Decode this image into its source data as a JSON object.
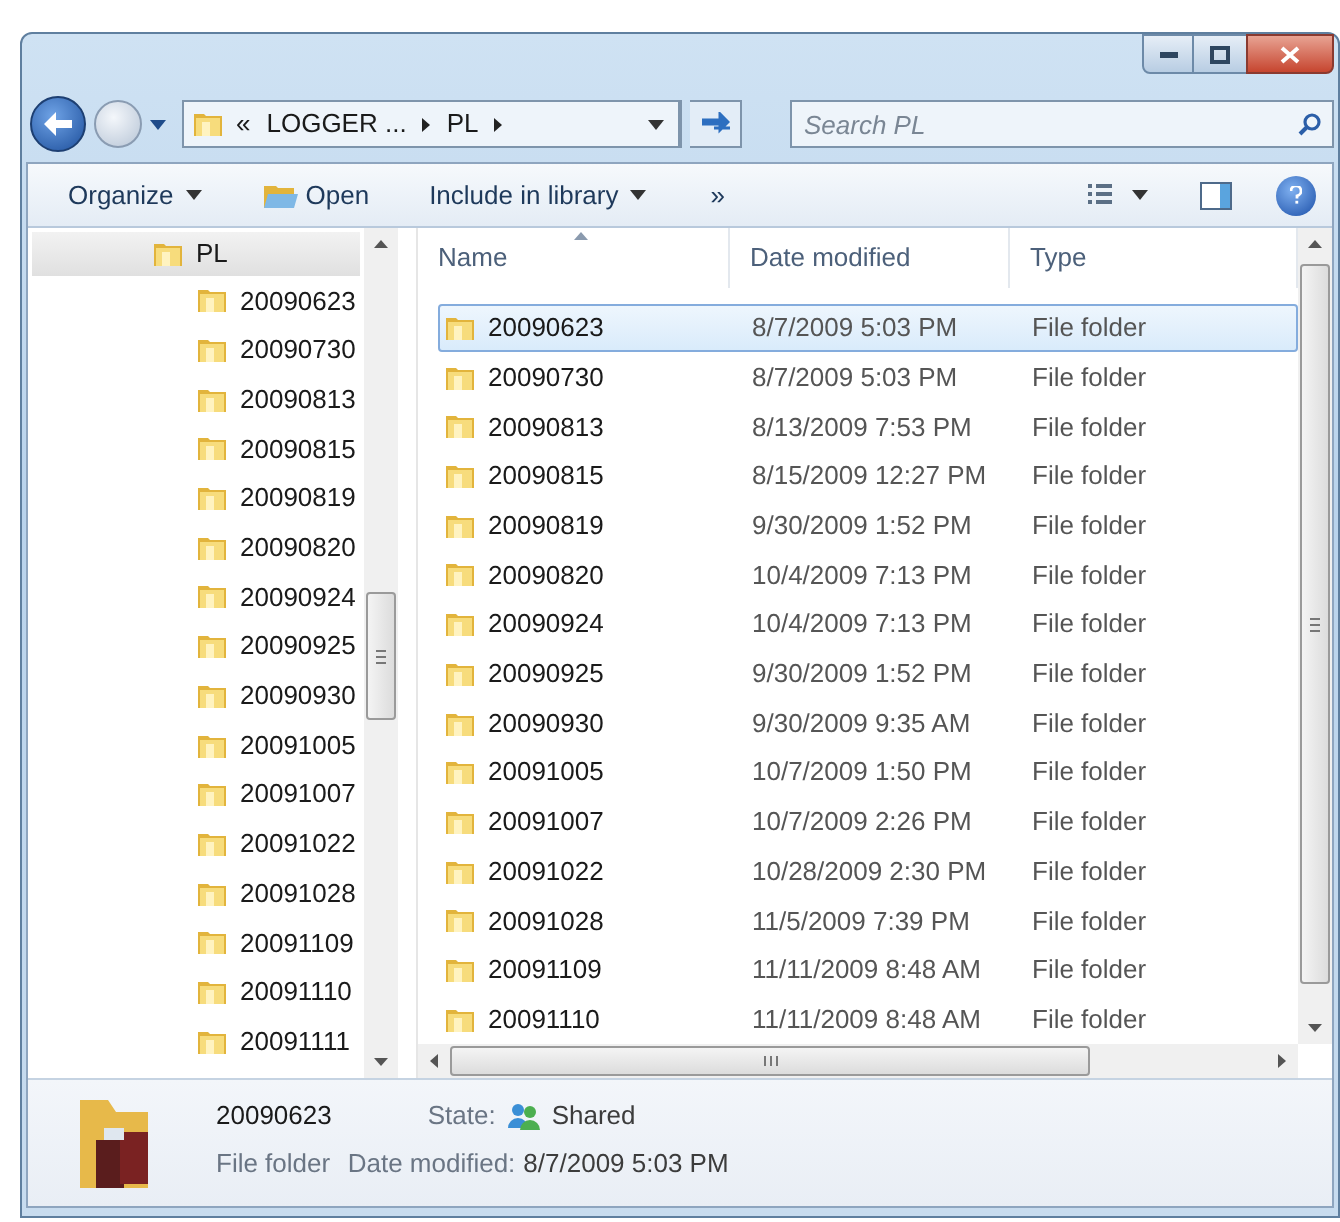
{
  "address": {
    "overflow": "«",
    "crumbs": [
      "LOGGER ...",
      "PL"
    ]
  },
  "search": {
    "placeholder": "Search PL"
  },
  "toolbar": {
    "items": [
      {
        "label": "Organize",
        "kind": "menu"
      },
      {
        "label": "Open",
        "kind": "icon"
      },
      {
        "label": "Include in library",
        "kind": "menu"
      },
      {
        "label": "»",
        "kind": "plain"
      }
    ]
  },
  "nav": {
    "items": [
      {
        "label": "PL",
        "selected": true,
        "children": [
          {
            "label": "20090623",
            "selected": false
          },
          {
            "label": "20090730",
            "selected": false
          },
          {
            "label": "20090813",
            "selected": false
          },
          {
            "label": "20090815",
            "selected": false
          },
          {
            "label": "20090819",
            "selected": false
          },
          {
            "label": "20090820",
            "selected": false
          },
          {
            "label": "20090924",
            "selected": false
          },
          {
            "label": "20090925",
            "selected": false
          },
          {
            "label": "20090930",
            "selected": false
          },
          {
            "label": "20091005",
            "selected": false
          },
          {
            "label": "20091007",
            "selected": false
          },
          {
            "label": "20091022",
            "selected": false
          },
          {
            "label": "20091028",
            "selected": false
          },
          {
            "label": "20091109",
            "selected": false
          },
          {
            "label": "20091110",
            "selected": false
          },
          {
            "label": "20091111",
            "selected": false
          }
        ]
      }
    ]
  },
  "table": {
    "columns": [
      {
        "label": "Name",
        "sorted": true
      },
      {
        "label": "Date modified",
        "sorted": false
      },
      {
        "label": "Type",
        "sorted": false
      }
    ],
    "rows": [
      {
        "name": "20090623",
        "date": "8/7/2009 5:03 PM",
        "type": "File folder",
        "selected": true
      },
      {
        "name": "20090730",
        "date": "8/7/2009 5:03 PM",
        "type": "File folder",
        "selected": false
      },
      {
        "name": "20090813",
        "date": "8/13/2009 7:53 PM",
        "type": "File folder",
        "selected": false
      },
      {
        "name": "20090815",
        "date": "8/15/2009 12:27 PM",
        "type": "File folder",
        "selected": false
      },
      {
        "name": "20090819",
        "date": "9/30/2009 1:52 PM",
        "type": "File folder",
        "selected": false
      },
      {
        "name": "20090820",
        "date": "10/4/2009 7:13 PM",
        "type": "File folder",
        "selected": false
      },
      {
        "name": "20090924",
        "date": "10/4/2009 7:13 PM",
        "type": "File folder",
        "selected": false
      },
      {
        "name": "20090925",
        "date": "9/30/2009 1:52 PM",
        "type": "File folder",
        "selected": false
      },
      {
        "name": "20090930",
        "date": "9/30/2009 9:35 AM",
        "type": "File folder",
        "selected": false
      },
      {
        "name": "20091005",
        "date": "10/7/2009 1:50 PM",
        "type": "File folder",
        "selected": false
      },
      {
        "name": "20091007",
        "date": "10/7/2009 2:26 PM",
        "type": "File folder",
        "selected": false
      },
      {
        "name": "20091022",
        "date": "10/28/2009 2:30 PM",
        "type": "File folder",
        "selected": false
      },
      {
        "name": "20091028",
        "date": "11/5/2009 7:39 PM",
        "type": "File folder",
        "selected": false
      },
      {
        "name": "20091109",
        "date": "11/11/2009 8:48 AM",
        "type": "File folder",
        "selected": false
      },
      {
        "name": "20091110",
        "date": "11/11/2009 8:48 AM",
        "type": "File folder",
        "selected": false
      }
    ]
  },
  "details": {
    "name": "20090623",
    "type": "File folder",
    "state_label": "State:",
    "state": "Shared",
    "date_label": "Date modified:",
    "date": "8/7/2009 5:03 PM"
  }
}
